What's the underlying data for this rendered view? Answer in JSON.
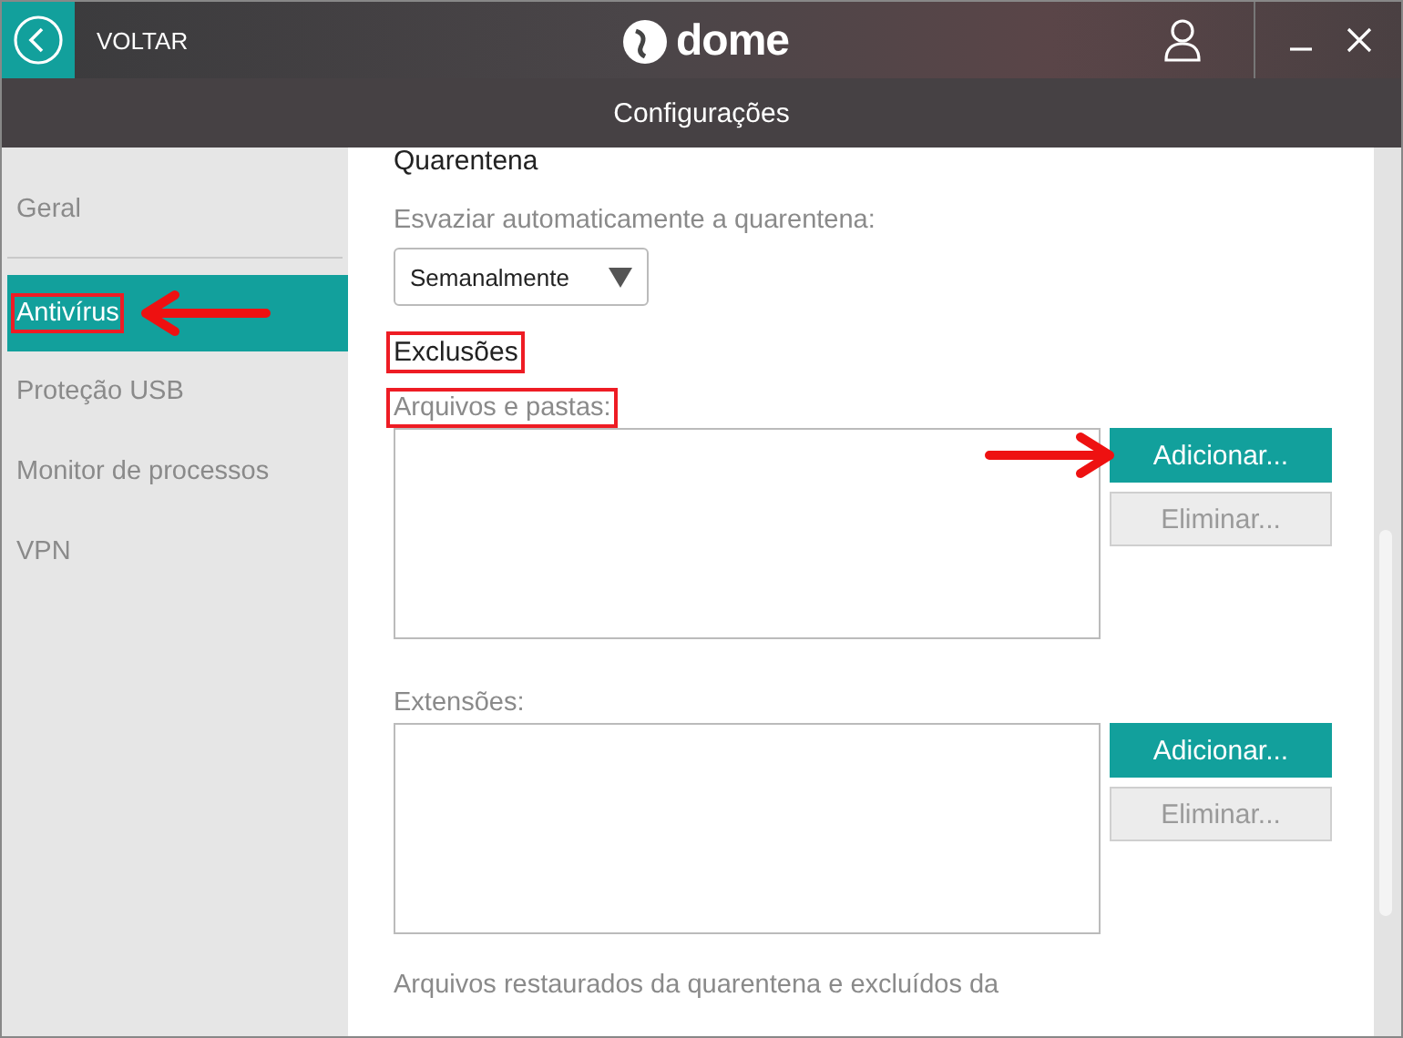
{
  "header": {
    "back_label": "VOLTAR",
    "logo_text": "dome"
  },
  "title": "Configurações",
  "sidebar": {
    "items": [
      {
        "label": "Geral",
        "selected": false,
        "annotated": false,
        "arrow": false
      },
      {
        "label": "Antivírus",
        "selected": true,
        "annotated": true,
        "arrow": true
      },
      {
        "label": "Proteção USB",
        "selected": false,
        "annotated": false,
        "arrow": false
      },
      {
        "label": "Monitor de processos",
        "selected": false,
        "annotated": false,
        "arrow": false
      },
      {
        "label": "VPN",
        "selected": false,
        "annotated": false,
        "arrow": false
      }
    ]
  },
  "quarantine": {
    "heading": "Quarentena",
    "label": "Esvaziar automaticamente a quarentena:",
    "dropdown_value": "Semanalmente"
  },
  "exclusions": {
    "heading": "Exclusões",
    "annotated": true,
    "lists": [
      {
        "label": "Arquivos e pastas:",
        "annotated": true,
        "buttons": [
          {
            "label": "Adicionar...",
            "disabled": false,
            "arrow": true
          },
          {
            "label": "Eliminar...",
            "disabled": true,
            "arrow": false
          }
        ]
      },
      {
        "label": "Extensões:",
        "annotated": false,
        "buttons": [
          {
            "label": "Adicionar...",
            "disabled": false,
            "arrow": false
          },
          {
            "label": "Eliminar...",
            "disabled": true,
            "arrow": false
          }
        ]
      }
    ]
  },
  "footer_text": "Arquivos restaurados da quarentena e excluídos da"
}
